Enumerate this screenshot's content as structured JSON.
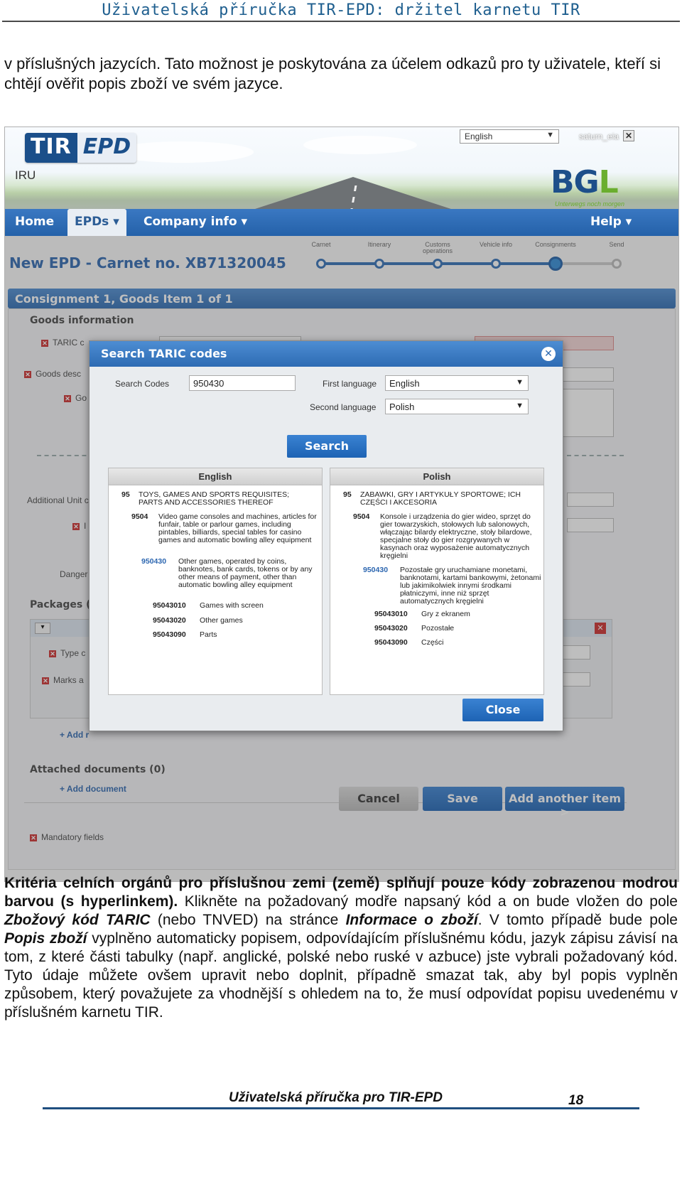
{
  "header": {
    "title": "Uživatelská příručka TIR-EPD: držitel karnetu TIR"
  },
  "intro": "v příslušných jazycích. Tato možnost je poskytována za účelem odkazů pro ty uživatele, kteří si chtějí ověřit popis zboží ve svém jazyce.",
  "app": {
    "logo_tir": "TIR",
    "logo_epd": "EPD",
    "org": "IRU",
    "language": "English",
    "user": "saturn_eia",
    "bgl_logo": "BGL",
    "bgl_tagline": "Unterwegs noch morgen",
    "nav": {
      "home": "Home",
      "epds": "EPDs ▾",
      "company": "Company info ▾",
      "help": "Help ▾"
    },
    "page_title": "New EPD - Carnet no. XB71320045",
    "steps": [
      "Carnet",
      "Itinerary",
      "Customs operations",
      "Vehicle info",
      "Consignments",
      "Send"
    ],
    "consignment_bar": "Consignment 1, Goods Item 1 of 1",
    "goods_info": "Goods information",
    "bg_labels": {
      "taric": "TARIC c",
      "goods_desc": "Goods desc",
      "go": "Go",
      "additional_unit": "Additional Unit c",
      "i": "I",
      "danger": "Danger",
      "packages": "Packages (1",
      "type": "Type c",
      "marks": "Marks a",
      "add_pkg": "+ Add r",
      "attached": "Attached documents (0)",
      "add_doc": "+ Add document",
      "mandatory": "Mandatory fields"
    },
    "buttons": {
      "cancel": "Cancel",
      "save": "Save",
      "add_another": "Add another item >"
    }
  },
  "modal": {
    "title": "Search TARIC codes",
    "search_codes_label": "Search Codes",
    "search_codes_value": "950430",
    "first_language_label": "First language",
    "first_language_value": "English",
    "second_language_label": "Second language",
    "second_language_value": "Polish",
    "search_button": "Search",
    "close_button": "Close",
    "english": {
      "header": "English",
      "rows": [
        {
          "code": "95",
          "desc": "TOYS, GAMES AND SPORTS REQUISITES; PARTS AND ACCESSORIES THEREOF"
        },
        {
          "code": "9504",
          "desc": "Video game consoles and machines, articles for funfair, table or parlour games, including pintables, billiards, special tables for casino games and automatic bowling alley equipment"
        },
        {
          "code": "950430",
          "desc": "Other games, operated by coins, banknotes, bank cards, tokens or by any other means of payment, other than automatic bowling alley equipment"
        },
        {
          "code": "95043010",
          "desc": "Games with screen"
        },
        {
          "code": "95043020",
          "desc": "Other games"
        },
        {
          "code": "95043090",
          "desc": "Parts"
        }
      ]
    },
    "polish": {
      "header": "Polish",
      "rows": [
        {
          "code": "95",
          "desc": "ZABAWKI, GRY I ARTYKUŁY SPORTOWE; ICH CZĘŚCI I AKCESORIA"
        },
        {
          "code": "9504",
          "desc": "Konsole i urządzenia do gier wideo, sprzęt do gier towarzyskich, stołowych lub salonowych, włączając bilardy elektryczne, stoły bilardowe, specjalne stoły do gier rozgrywanych w kasynach oraz wyposażenie automatycznych kręgielni"
        },
        {
          "code": "950430",
          "desc": "Pozostałe gry uruchamiane monetami, banknotami, kartami bankowymi, żetonami lub jakimikolwiek innymi środkami płatniczymi, inne niż sprzęt automatycznych kręgielni"
        },
        {
          "code": "95043010",
          "desc": "Gry z ekranem"
        },
        {
          "code": "95043020",
          "desc": "Pozostałe"
        },
        {
          "code": "95043090",
          "desc": "Części"
        }
      ]
    }
  },
  "body": {
    "b1": "Kritéria celních orgánů pro příslušnou zemi (země) splňují pouze kódy zobrazenou modrou barvou (s hyperlinkem).",
    "t1": " Klikněte na požadovaný modře napsaný kód a on bude vložen do pole ",
    "bi1": "Zbožový kód TARIC",
    "t2": " (nebo TNVED) na stránce ",
    "bi2": "Informace o zboží",
    "t3": ". V tomto případě bude pole ",
    "bi3": "Popis zboží",
    "t4": " vyplněno automaticky popisem, odpovídajícím příslušnému kódu, jazyk zápisu závisí na tom, z které části tabulky (např. anglické, polské nebo ruské v azbuce) jste vybrali požadovaný kód. Tyto údaje můžete ovšem upravit nebo doplnit, případně smazat tak, aby byl popis vyplněn způsobem, který považujete za vhodnější s ohledem na to, že musí odpovídat popisu uvedenému v příslušném karnetu TIR."
  },
  "footer": {
    "title": "Uživatelská příručka pro TIR-EPD",
    "page": "18"
  }
}
